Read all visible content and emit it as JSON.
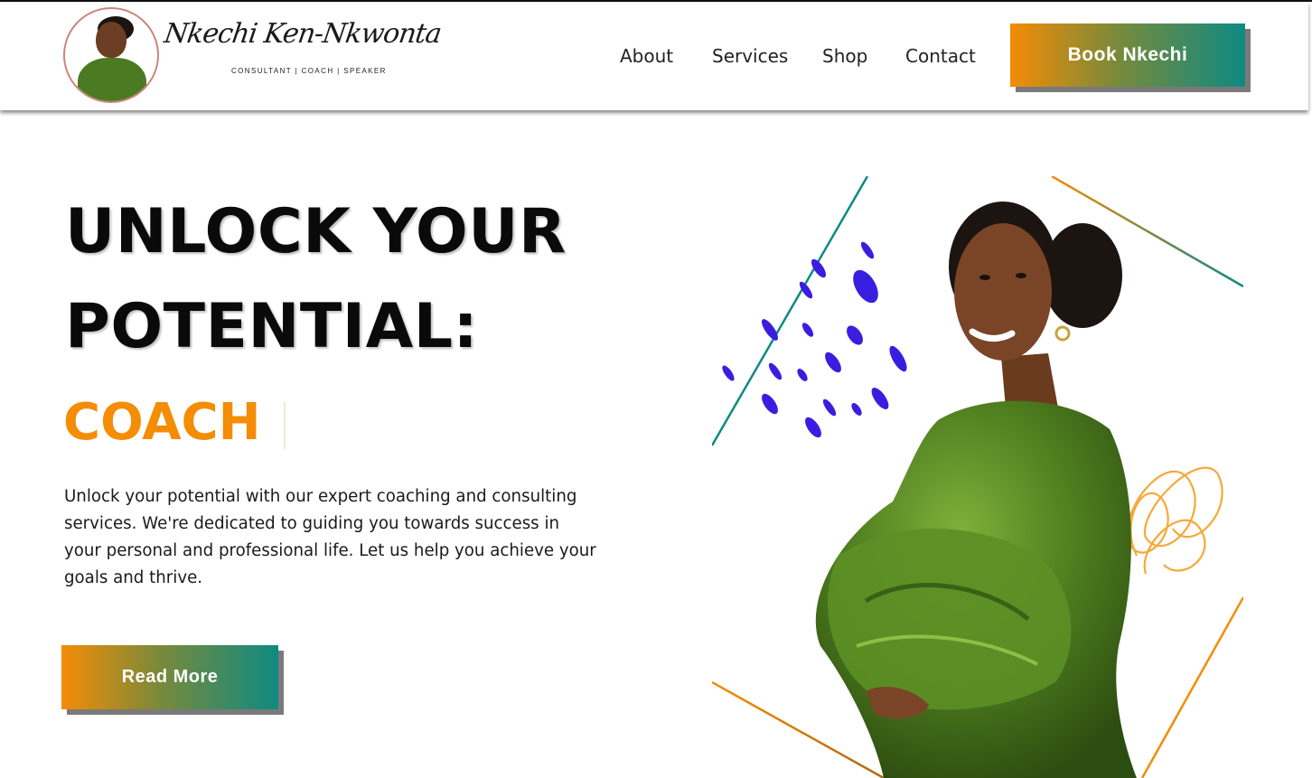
{
  "header": {
    "logo_name": "Nkechi Ken-Nkwonta",
    "logo_tagline": "CONSULTANT | COACH | SPEAKER",
    "nav": [
      {
        "label": "About"
      },
      {
        "label": "Services"
      },
      {
        "label": "Shop"
      },
      {
        "label": "Contact"
      }
    ],
    "cta_label": "Book Nkechi"
  },
  "hero": {
    "headline_line1": "UNLOCK YOUR",
    "headline_line2": "POTENTIAL:",
    "rotating_word": "COACH",
    "description": "Unlock your potential with our expert coaching and consulting services. We're dedicated to guiding you towards success in your personal and professional life. Let us help you achieve your goals and thrive.",
    "button_label": "Read More"
  },
  "colors": {
    "accent_orange": "#f48c06",
    "accent_teal": "#0e8a82",
    "dot_blue": "#3a1ee0",
    "dress_green": "#4f7f1f"
  }
}
